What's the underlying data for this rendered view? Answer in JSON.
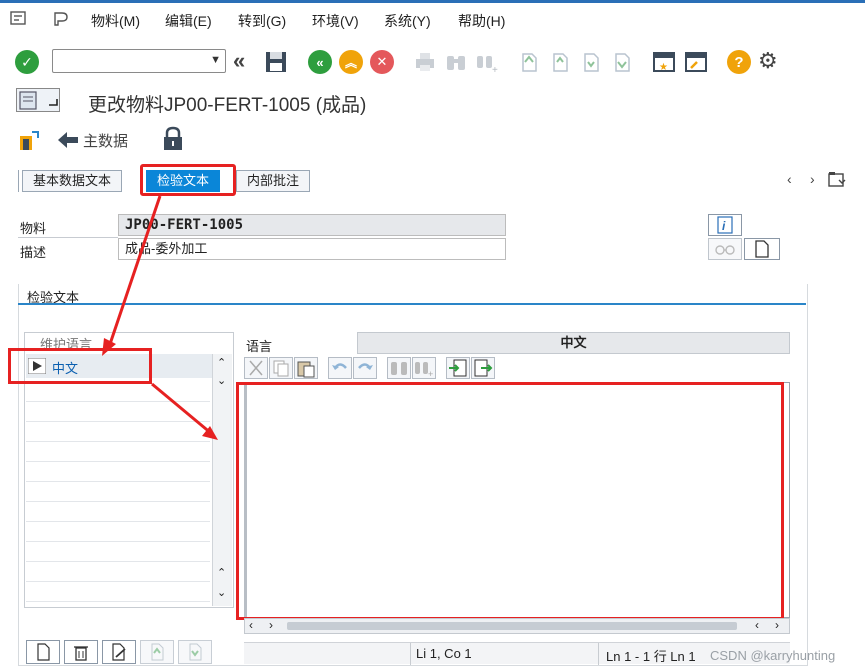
{
  "menubar": {
    "items": [
      {
        "label": "物料(M)"
      },
      {
        "label": "编辑(E)"
      },
      {
        "label": "转到(G)"
      },
      {
        "label": "环境(V)"
      },
      {
        "label": "系统(Y)"
      },
      {
        "label": "帮助(H)"
      }
    ]
  },
  "toolbar": {
    "command_field_value": ""
  },
  "title": {
    "text": "更改物料JP00-FERT-1005 (成品)"
  },
  "subbar": {
    "main_data_label": "主数据"
  },
  "tabs": [
    {
      "label": "基本数据文本"
    },
    {
      "label": "检验文本"
    },
    {
      "label": "内部批注"
    }
  ],
  "fields": {
    "material_label": "物料",
    "material_value": "JP00-FERT-1005",
    "desc_label": "描述",
    "desc_value": "成品-委外加工"
  },
  "section": {
    "title": "检验文本"
  },
  "language_list": {
    "header": "维护语言",
    "items": [
      {
        "label": "中文"
      }
    ]
  },
  "editor": {
    "lang_label": "语言",
    "lang_value": "中文"
  },
  "statusbar": {
    "position": "Li 1, Co 1",
    "lines": "Ln 1 - 1 行 Ln 1"
  },
  "watermark": "CSDN @karryhunting",
  "colors": {
    "accent": "#0a86d8",
    "highlight": "#e62121",
    "ok_green": "#2e9e3e",
    "warn_orange": "#f0a30a",
    "cancel_red": "#e4585b"
  }
}
